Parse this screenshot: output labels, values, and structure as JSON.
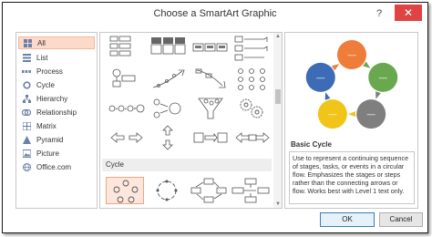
{
  "window": {
    "title": "Choose a SmartArt Graphic",
    "help_label": "?",
    "close_label": "✕"
  },
  "categories": [
    {
      "label": "All",
      "icon": "grid-icon",
      "selected": true
    },
    {
      "label": "List",
      "icon": "list-icon"
    },
    {
      "label": "Process",
      "icon": "process-icon"
    },
    {
      "label": "Cycle",
      "icon": "cycle-icon"
    },
    {
      "label": "Hierarchy",
      "icon": "hierarchy-icon"
    },
    {
      "label": "Relationship",
      "icon": "relationship-icon"
    },
    {
      "label": "Matrix",
      "icon": "matrix-icon"
    },
    {
      "label": "Pyramid",
      "icon": "pyramid-icon"
    },
    {
      "label": "Picture",
      "icon": "picture-icon"
    },
    {
      "label": "Office.com",
      "icon": "globe-icon"
    }
  ],
  "gallery": {
    "section_cycle": "Cycle"
  },
  "preview": {
    "name": "Basic Cycle",
    "description": "Use to represent a continuing sequence of stages, tasks, or events in a circular flow. Emphasizes the stages or steps rather than the connecting arrows or flow. Works best with Level 1 text only.",
    "node_colors": [
      "#ee7d3a",
      "#6aa84f",
      "#7f7f7f",
      "#f0c419",
      "#3d6bb6"
    ],
    "node_label": "—"
  },
  "buttons": {
    "ok": "OK",
    "cancel": "Cancel"
  }
}
